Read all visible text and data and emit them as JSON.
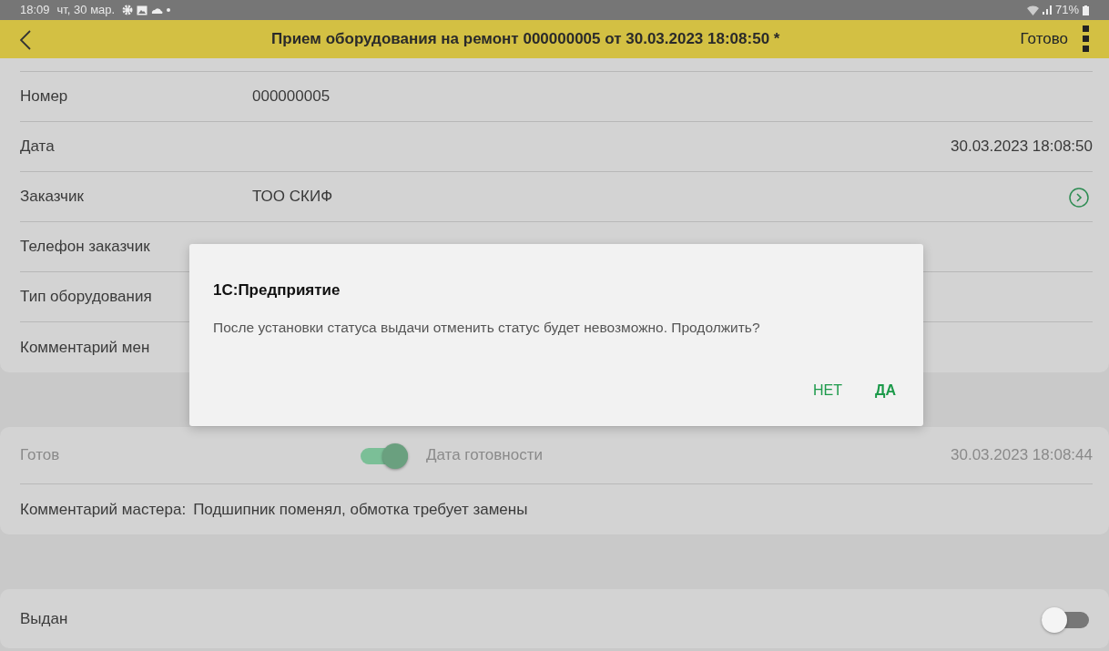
{
  "status_bar": {
    "time": "18:09",
    "date": "чт, 30 мар.",
    "battery": "71%"
  },
  "header": {
    "title": "Прием оборудования на ремонт 000000005 от 30.03.2023 18:08:50 *",
    "done": "Готово"
  },
  "fields": [
    {
      "kind": "left",
      "label": "Номер",
      "value": "000000005"
    },
    {
      "kind": "right",
      "label": "Дата",
      "value": "30.03.2023 18:08:50"
    },
    {
      "kind": "link",
      "label": "Заказчик",
      "value": "ТОО СКИФ"
    },
    {
      "kind": "label",
      "label": "Телефон заказчик"
    },
    {
      "kind": "label",
      "label": "Тип оборудования"
    },
    {
      "kind": "label",
      "label": "Комментарий мен"
    }
  ],
  "ready": {
    "label": "Готов",
    "on": true,
    "disabled": true,
    "date_label": "Дата готовности",
    "date": "30.03.2023 18:08:44"
  },
  "master_comment": {
    "label": "Комментарий мастера:",
    "value": "Подшипник поменял, обмотка требует замены"
  },
  "issued": {
    "label": "Выдан",
    "on": false,
    "disabled": false
  },
  "dialog": {
    "title": "1С:Предприятие",
    "message": "После установки статуса выдачи отменить статус будет невозможно. Продолжить?",
    "buttons": [
      "НЕТ",
      "ДА"
    ]
  }
}
